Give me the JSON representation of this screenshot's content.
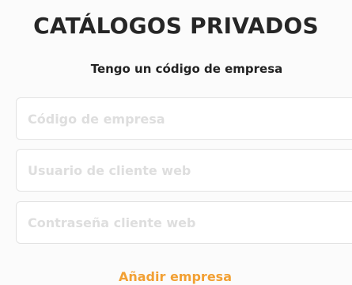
{
  "header": {
    "title": "CATÁLOGOS PRIVADOS",
    "subtitle": "Tengo un código de empresa"
  },
  "form": {
    "company_code": {
      "value": "",
      "placeholder": "Código de empresa"
    },
    "web_user": {
      "value": "",
      "placeholder": "Usuario de cliente web"
    },
    "web_password": {
      "value": "",
      "placeholder": "Contraseña cliente web"
    }
  },
  "actions": {
    "add_company_label": "Añadir empresa"
  },
  "colors": {
    "accent": "#f2a033",
    "title_text": "#262626",
    "placeholder": "#dedede",
    "field_border": "#e3e3e3",
    "background": "#fbfbfb"
  }
}
